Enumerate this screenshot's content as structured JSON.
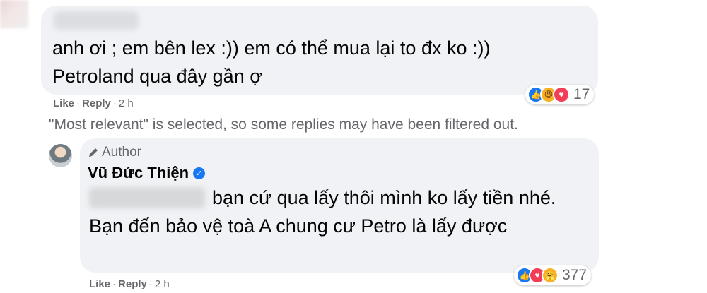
{
  "comment1": {
    "text_line1": "anh ơi ; em bên lex :)) em có thể mua lại to đx ko :))",
    "text_line2": "Petroland qua đây gần ợ",
    "like_label": "Like",
    "reply_label": "Reply",
    "time": "2 h",
    "reaction_count": "17",
    "reaction_icons": [
      "like-icon",
      "haha-icon",
      "love-icon"
    ]
  },
  "filter_note": "\"Most relevant\" is selected, so some replies may have been filtered out.",
  "reply": {
    "author_badge": "Author",
    "author_name": "Vũ Đức Thiện",
    "text": "bạn cứ qua lấy thôi mình ko lấy tiền nhé. Bạn đến bảo vệ toà A chung cư Petro là lấy được",
    "like_label": "Like",
    "reply_label": "Reply",
    "time": "2 h",
    "reaction_count": "377",
    "reaction_icons": [
      "like-icon",
      "love-icon",
      "care-icon"
    ]
  },
  "colors": {
    "bubble": "#f0f2f5",
    "meta_text": "#65676b",
    "like_blue": "#1877f2",
    "love_red": "#f33e58",
    "haha_yellow": "#f7b125"
  }
}
